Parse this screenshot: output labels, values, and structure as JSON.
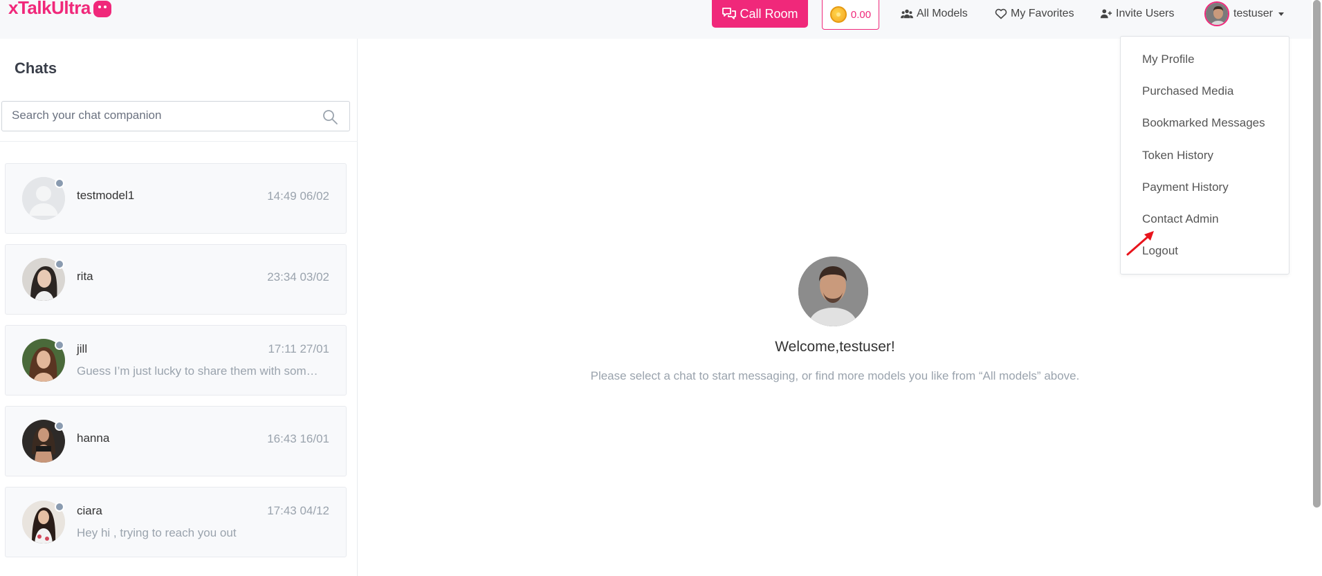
{
  "brand": {
    "logo_text_1": "xTalk",
    "logo_text_2": "Ultra"
  },
  "header": {
    "call_room_label": "Call Room",
    "token_balance": "0.00",
    "all_models_label": "All Models",
    "favorites_label": "My Favorites",
    "invite_label": "Invite Users",
    "username": "testuser"
  },
  "sidebar": {
    "title": "Chats",
    "search_placeholder": "Search your chat companion",
    "chats": [
      {
        "name": "testmodel1",
        "time": "14:49 06/02",
        "preview": ""
      },
      {
        "name": "rita",
        "time": "23:34 03/02",
        "preview": ""
      },
      {
        "name": "jill",
        "time": "17:11 27/01",
        "preview": "Guess I’m just lucky to share them with som…"
      },
      {
        "name": "hanna",
        "time": "16:43 16/01",
        "preview": ""
      },
      {
        "name": "ciara",
        "time": "17:43 04/12",
        "preview": "Hey hi , trying to reach you out"
      }
    ]
  },
  "main": {
    "welcome_title": "Welcome,testuser!",
    "welcome_subtitle": "Please select a chat to start messaging, or find more models you like from “All models” above."
  },
  "dropdown": {
    "items": [
      "My Profile",
      "Purchased Media",
      "Bookmarked Messages",
      "Token History",
      "Payment History",
      "Contact Admin",
      "Logout"
    ]
  },
  "colors": {
    "accent": "#f0287a",
    "muted": "#9aa3ad",
    "annotation": "#e8141c"
  }
}
